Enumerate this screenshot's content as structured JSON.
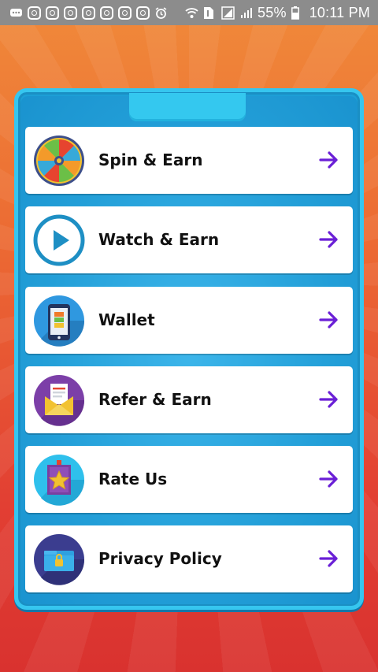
{
  "status_bar": {
    "battery": "55%",
    "time": "10:11 PM",
    "background": "#8c8c8c"
  },
  "menu": {
    "items": [
      {
        "label": "Spin & Earn",
        "icon": "wheel-icon"
      },
      {
        "label": "Watch & Earn",
        "icon": "play-icon"
      },
      {
        "label": "Wallet",
        "icon": "wallet-phone-icon"
      },
      {
        "label": "Refer & Earn",
        "icon": "envelope-icon"
      },
      {
        "label": "Rate Us",
        "icon": "star-icon"
      },
      {
        "label": "Privacy Policy",
        "icon": "lock-folder-icon"
      }
    ],
    "arrow_icon": "arrow-right-icon",
    "arrow_color": "#6a1fd6"
  },
  "colors": {
    "background_top": "#f08a3a",
    "background_bottom": "#d9322f",
    "panel": "#1c9fd6",
    "panel_border": "#36c6ef"
  }
}
